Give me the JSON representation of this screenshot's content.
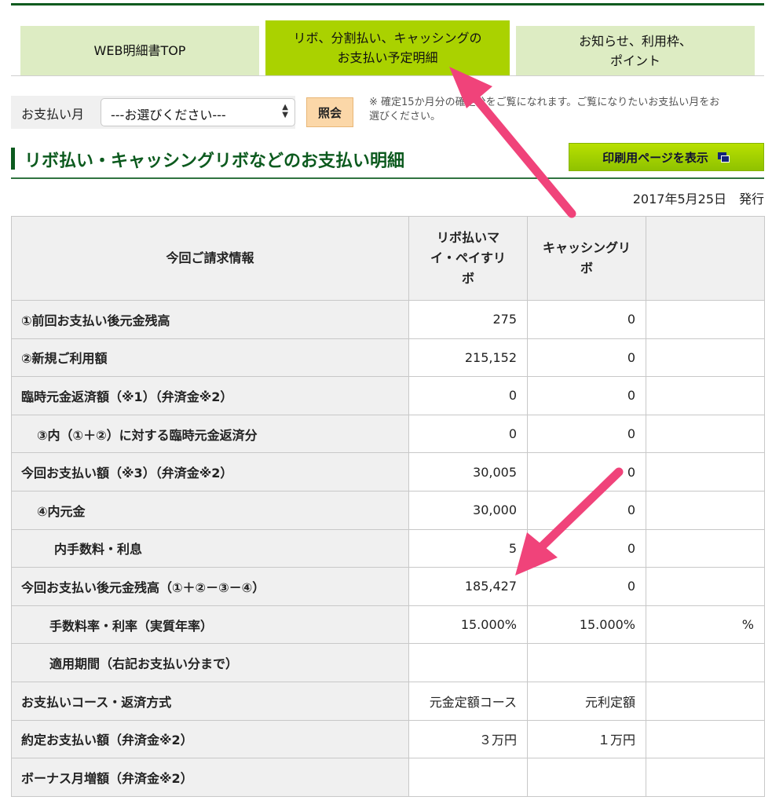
{
  "tabs": [
    {
      "label": "WEB明細書TOP"
    },
    {
      "label_line1": "リボ、分割払い、キャッシングの",
      "label_line2": "お支払い予定明細"
    },
    {
      "label_line1": "お知らせ、利用枠、",
      "label_line2": "ポイント"
    }
  ],
  "payment_month": {
    "label": "お支払い月",
    "select_value": "---お選びください---",
    "button": "照会",
    "note": "※ 確定15か月分の確定分をご覧になれます。ご覧になりたいお支払い月をお選びください。"
  },
  "section": {
    "title": "リボ払い・キャッシングリボなどのお支払い明細",
    "print_button": "印刷用ページを表示",
    "issued": "2017年5月25日　発行"
  },
  "table": {
    "header": {
      "label": "今回ご請求情報",
      "col1": "リボ払いマイ・ペイすリボ",
      "col2": "キャッシングリボ",
      "col3": ""
    },
    "rows": [
      {
        "label": "①前回お支払い後元金残高",
        "c1": "275",
        "c2": "0",
        "c3": ""
      },
      {
        "label": "②新規ご利用額",
        "c1": "215,152",
        "c2": "0",
        "c3": ""
      },
      {
        "label": "臨時元金返済額（※1）（弁済金※2）",
        "c1": "0",
        "c2": "0",
        "c3": ""
      },
      {
        "label": "③内（①＋②）に対する臨時元金返済分",
        "c1": "0",
        "c2": "0",
        "c3": ""
      },
      {
        "label": "今回お支払い額（※3）（弁済金※2）",
        "c1": "30,005",
        "c2": "0",
        "c3": ""
      },
      {
        "label": "④内元金",
        "c1": "30,000",
        "c2": "0",
        "c3": ""
      },
      {
        "label": "内手数料・利息",
        "c1": "5",
        "c2": "0",
        "c3": ""
      },
      {
        "label": "今回お支払い後元金残高（①＋②－③－④）",
        "c1": "185,427",
        "c2": "0",
        "c3": ""
      },
      {
        "label": "手数料率・利率（実質年率）",
        "c1": "15.000%",
        "c2": "15.000%",
        "c3": "%"
      },
      {
        "label": "適用期間（右記お支払い分まで）",
        "c1": "",
        "c2": "",
        "c3": ""
      },
      {
        "label": "お支払いコース・返済方式",
        "c1": "元金定額コース",
        "c2": "元利定額",
        "c3": ""
      },
      {
        "label": "約定お支払い額（弁済金※2）",
        "c1": "３万円",
        "c2": "１万円",
        "c3": ""
      },
      {
        "label": "ボーナス月増額（弁済金※2）",
        "c1": "",
        "c2": "",
        "c3": ""
      }
    ]
  },
  "colors": {
    "accent_green": "#0c5a1e",
    "tab_active": "#aad200",
    "tab_inactive": "#ddecc3",
    "annotation_arrow": "#f0437a"
  },
  "icons": [
    "select-arrows-icon",
    "print-window-icon"
  ]
}
